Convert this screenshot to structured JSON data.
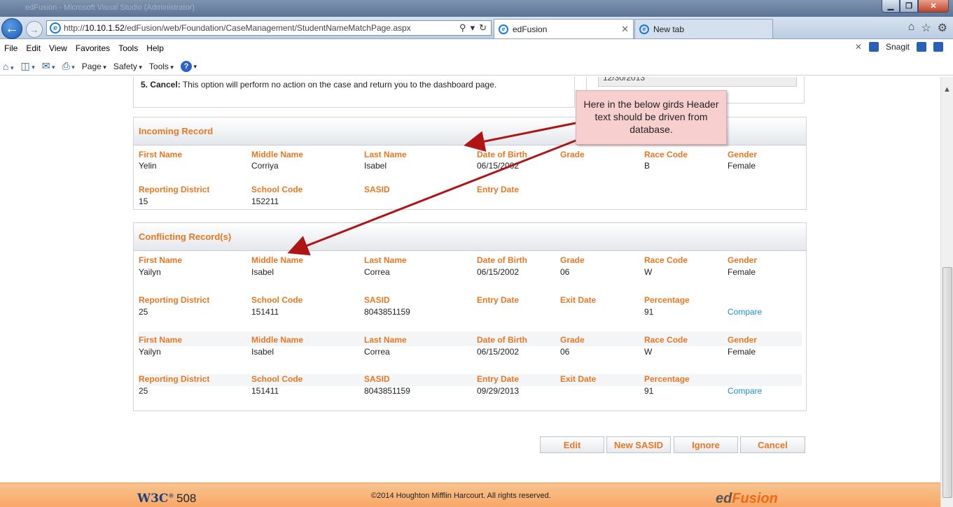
{
  "browser": {
    "ghost_title": "edFusion - Microsoft Visual Studio (Administrator)",
    "address_bar": {
      "url_prefix": "http://",
      "url_host": "10.10.1.52",
      "url_path": "/edFusion/web/Foundation/CaseManagement/StudentNameMatchPage.aspx"
    },
    "tabs": [
      {
        "label": "edFusion",
        "active": true
      },
      {
        "label": "New tab",
        "active": false
      }
    ],
    "menu": [
      "File",
      "Edit",
      "View",
      "Favorites",
      "Tools",
      "Help"
    ],
    "menu_right": {
      "snagit": "Snagit"
    },
    "commandbar": {
      "page": "Page",
      "safety": "Safety",
      "tools": "Tools"
    }
  },
  "instructions": {
    "item_num": "5. Cancel:",
    "item_text": " This option will perform no action on the case and return you to the dashboard page."
  },
  "side_panel": {
    "date_value": "12/30/2013"
  },
  "annotation": {
    "text": "Here in the below girds Header text should be driven from database."
  },
  "incoming": {
    "title": "Incoming Record",
    "row1": {
      "labels": [
        "First Name",
        "Middle Name",
        "Last Name",
        "Date of Birth",
        "Grade",
        "Race Code",
        "Gender"
      ],
      "values": [
        "Yelin",
        "Corriya",
        "Isabel",
        "06/15/2002",
        "",
        "B",
        "Female"
      ]
    },
    "row2": {
      "labels": [
        "Reporting District",
        "School Code",
        "SASID",
        "Entry Date"
      ],
      "values": [
        "15",
        "152211",
        "",
        ""
      ]
    }
  },
  "conflicting": {
    "title": "Conflicting Record(s)",
    "records": [
      {
        "row1": {
          "labels": [
            "First Name",
            "Middle Name",
            "Last Name",
            "Date of Birth",
            "Grade",
            "Race Code",
            "Gender"
          ],
          "values": [
            "Yailyn",
            "Isabel",
            "Correa",
            "06/15/2002",
            "06",
            "W",
            "Female"
          ]
        },
        "row2": {
          "labels": [
            "Reporting District",
            "School Code",
            "SASID",
            "Entry Date",
            "Exit Date",
            "Percentage"
          ],
          "values": [
            "25",
            "151411",
            "8043851159",
            "",
            "",
            "91"
          ],
          "link": "Compare"
        }
      },
      {
        "row1": {
          "labels": [
            "First Name",
            "Middle Name",
            "Last Name",
            "Date of Birth",
            "Grade",
            "Race Code",
            "Gender"
          ],
          "values": [
            "Yailyn",
            "Isabel",
            "Correa",
            "06/15/2002",
            "06",
            "W",
            "Female"
          ]
        },
        "row2": {
          "labels": [
            "Reporting District",
            "School Code",
            "SASID",
            "Entry Date",
            "Exit Date",
            "Percentage"
          ],
          "values": [
            "25",
            "151411",
            "8043851159",
            "09/29/2013",
            "",
            "91"
          ],
          "link": "Compare"
        }
      }
    ]
  },
  "buttons": {
    "edit": "Edit",
    "new_sasid": "New SASID",
    "ignore": "Ignore",
    "cancel": "Cancel"
  },
  "footer": {
    "w3c": "W3C",
    "s508": "508",
    "copyright": "©2014 Houghton Mifflin Harcourt. All rights reserved.",
    "logo_a": "ed",
    "logo_b": "Fusion"
  },
  "colors": {
    "accent": "#e87722",
    "link": "#1f8fcf",
    "footer": "#f7a867",
    "annotation": "#f8cfcf"
  }
}
